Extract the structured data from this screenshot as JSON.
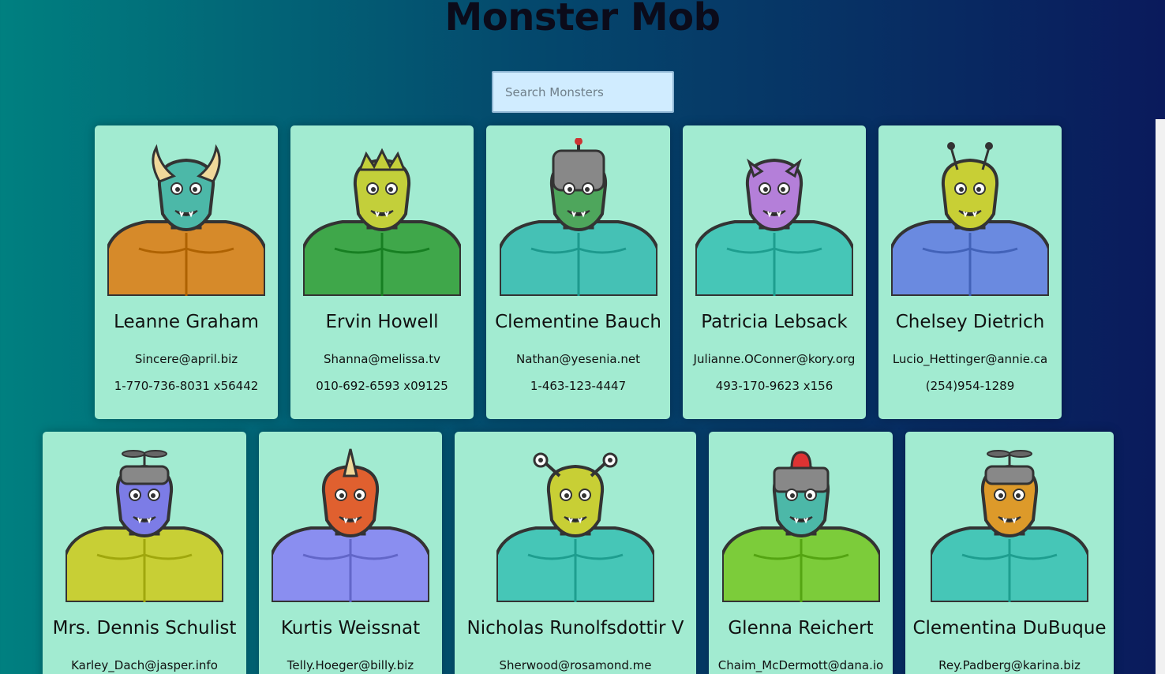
{
  "page": {
    "title": "Monster Mob"
  },
  "search": {
    "placeholder": "Search Monsters"
  },
  "monsters": [
    {
      "name": "Leanne Graham",
      "email": "Sincere@april.biz",
      "phone": "1-770-736-8031 x56442",
      "skin": "#4cb8a8",
      "body": "#d68a2a",
      "horns": "horns"
    },
    {
      "name": "Ervin Howell",
      "email": "Shanna@melissa.tv",
      "phone": "010-692-6593 x09125",
      "skin": "#c3cf3a",
      "body": "#3fa74a",
      "horns": "spikes"
    },
    {
      "name": "Clementine Bauch",
      "email": "Nathan@yesenia.net",
      "phone": "1-463-123-4447",
      "skin": "#4ea65c",
      "body": "#45c1b5",
      "horns": "helmet"
    },
    {
      "name": "Patricia Lebsack",
      "email": "Julianne.OConner@kory.org",
      "phone": "493-170-9623 x156",
      "skin": "#b47fd9",
      "body": "#46c6b7",
      "horns": "small-horns"
    },
    {
      "name": "Chelsey Dietrich",
      "email": "Lucio_Hettinger@annie.ca",
      "phone": "(254)954-1289",
      "skin": "#c8cf35",
      "body": "#6a8ae0",
      "horns": "antennae"
    },
    {
      "name": "Mrs. Dennis Schulist",
      "email": "Karley_Dach@jasper.info",
      "phone": "",
      "skin": "#7c7ce6",
      "body": "#c8cf35",
      "horns": "propeller"
    },
    {
      "name": "Kurtis Weissnat",
      "email": "Telly.Hoeger@billy.biz",
      "phone": "",
      "skin": "#e0602f",
      "body": "#8a8ef0",
      "horns": "horn"
    },
    {
      "name": "Nicholas Runolfsdottir V",
      "email": "Sherwood@rosamond.me",
      "phone": "",
      "skin": "#c8cf35",
      "body": "#46c6b7",
      "horns": "eye-stalks"
    },
    {
      "name": "Glenna Reichert",
      "email": "Chaim_McDermott@dana.io",
      "phone": "",
      "skin": "#4cb8a8",
      "body": "#7ccc3a",
      "horns": "siren"
    },
    {
      "name": "Clementina DuBuque",
      "email": "Rey.Padberg@karina.biz",
      "phone": "",
      "skin": "#dd9a2a",
      "body": "#46c6b7",
      "horns": "propeller"
    }
  ]
}
